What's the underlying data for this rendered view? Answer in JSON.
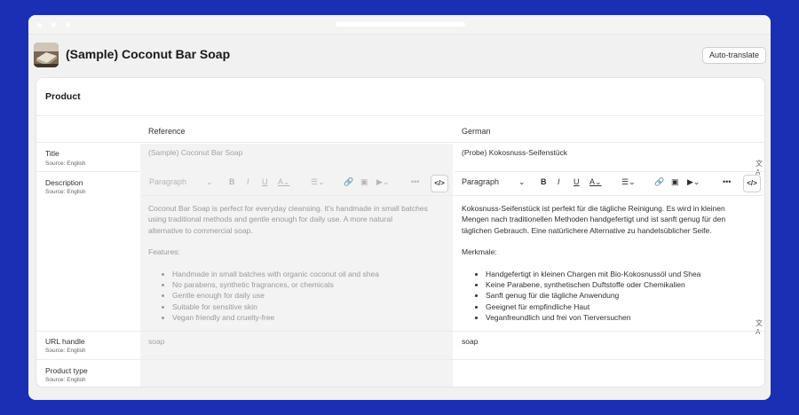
{
  "header": {
    "title": "(Sample) Coconut Bar Soap",
    "auto_translate_label": "Auto-translate"
  },
  "card": {
    "title": "Product",
    "columns": {
      "reference": "Reference",
      "german": "German"
    }
  },
  "rows": {
    "title": {
      "label": "Title",
      "source": "Source: English",
      "reference": "(Sample) Coconut Bar Soap",
      "german": "(Probe) Kokosnuss-Seifenstück"
    },
    "description": {
      "label": "Description",
      "source": "Source: English"
    },
    "url_handle": {
      "label": "URL handle",
      "source": "Source: English",
      "reference": "soap",
      "german": "soap"
    },
    "product_type": {
      "label": "Product type",
      "source": "Source: English"
    }
  },
  "toolbar": {
    "paragraph_label": "Paragraph",
    "code_label": "</>"
  },
  "reference_description": {
    "intro": [
      "Coconut Bar Soap is perfect for everyday cleansing. It's handmade in small batches",
      "using traditional methods and gentle enough for daily use. A more natural",
      "alternative to commercial soap."
    ],
    "features_label": "Features:",
    "features": [
      "Handmade in small batches with organic coconut oil and shea",
      "No parabens, synthetic fragrances, or chemicals",
      "Gentle enough for daily use",
      "Suitable for sensitive skin",
      "Vegan friendly and cruelty-free"
    ]
  },
  "german_description": {
    "intro": [
      "Kokosnuss-Seifenstück ist perfekt für die tägliche Reinigung. Es wird in kleinen",
      "Mengen nach traditionellen Methoden handgefertigt und ist sanft genug für den",
      "täglichen Gebrauch. Eine natürlichere Alternative zu handelsüblicher Seife."
    ],
    "features_label": "Merkmale:",
    "features": [
      "Handgefertigt in kleinen Chargen mit Bio-Kokosnussöl und Shea",
      "Keine Parabene, synthetischen Duftstoffe oder Chemikalien",
      "Sanft genug für die tägliche Anwendung",
      "Geeignet für empfindliche Haut",
      "Veganfreundlich und frei von Tierversuchen"
    ]
  },
  "colors": {
    "background": "#1b2fb5",
    "window": "#f1f1f1",
    "card": "#ffffff",
    "reference_column": "#f3f3f3"
  },
  "icons": {
    "bold": "bold-icon",
    "italic": "italic-icon",
    "underline": "underline-icon",
    "text_color": "text-color-icon",
    "align": "align-icon",
    "link": "link-icon",
    "image": "image-icon",
    "video": "video-icon",
    "more": "more-icon",
    "translate": "translate-icon"
  }
}
